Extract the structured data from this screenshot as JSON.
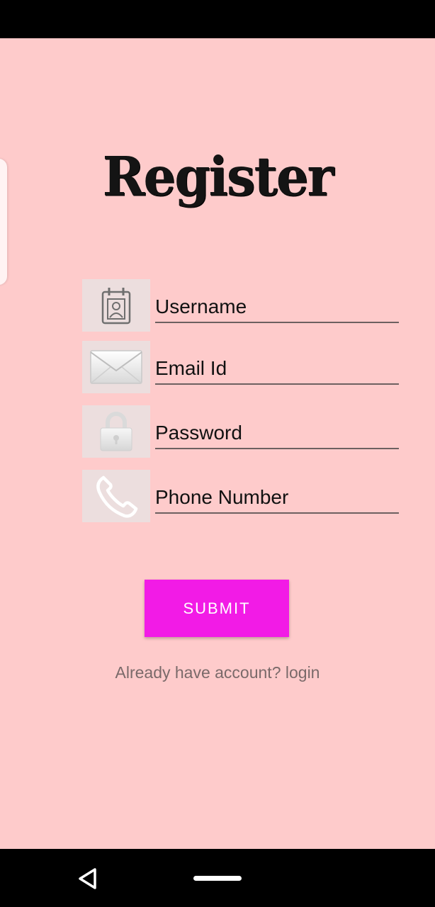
{
  "header": {
    "title": "Register"
  },
  "form": {
    "fields": [
      {
        "placeholder": "Username",
        "icon": "contact-card-icon",
        "type": "text"
      },
      {
        "placeholder": "Email Id",
        "icon": "envelope-icon",
        "type": "email"
      },
      {
        "placeholder": "Password",
        "icon": "lock-icon",
        "type": "password"
      },
      {
        "placeholder": "Phone Number",
        "icon": "phone-icon",
        "type": "tel"
      }
    ],
    "submit_label": "SUBMIT",
    "login_prompt": "Already have account? login"
  },
  "navigation": {
    "back_icon": "back-triangle-icon",
    "home_icon": "home-pill-icon"
  },
  "colors": {
    "background": "#fecbcb",
    "accent": "#f21be6",
    "icon_box": "#ecdede"
  }
}
